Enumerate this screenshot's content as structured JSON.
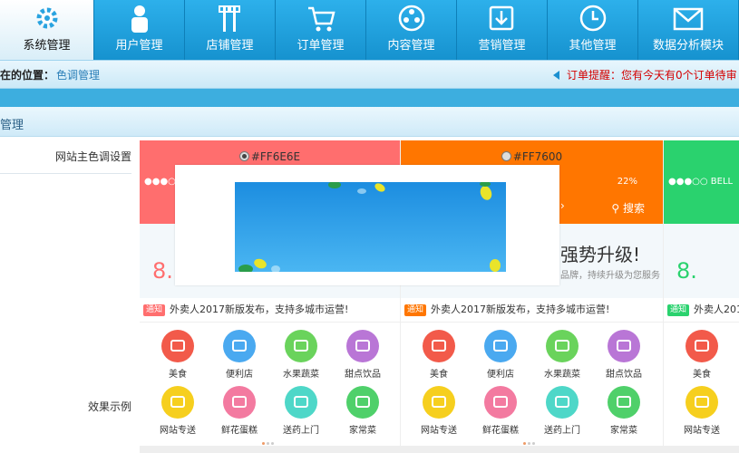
{
  "nav": {
    "tabs": [
      {
        "label": "系统管理",
        "icon": "gear-icon",
        "active": true
      },
      {
        "label": "用户管理",
        "icon": "user-icon",
        "active": false
      },
      {
        "label": "店铺管理",
        "icon": "tools-icon",
        "active": false
      },
      {
        "label": "订单管理",
        "icon": "cart-icon",
        "active": false
      },
      {
        "label": "内容管理",
        "icon": "film-reel-icon",
        "active": false
      },
      {
        "label": "营销管理",
        "icon": "download-box-icon",
        "active": false
      },
      {
        "label": "其他管理",
        "icon": "clock-icon",
        "active": false
      },
      {
        "label": "数据分析模块",
        "icon": "envelope-icon",
        "active": false
      }
    ]
  },
  "breadcrumb": {
    "prefix": "现在的位置：",
    "current": "色调管理"
  },
  "order_alert": {
    "label": "订单提醒：",
    "text": "您有今天有0个订单待审"
  },
  "section": {
    "title": "色调管理"
  },
  "form": {
    "theme_label": "网站主色调设置",
    "preview_label": "效果示例"
  },
  "themes": [
    {
      "hex": "#FF6E6E",
      "color": "#ff6e6e",
      "selected": true,
      "status_left": "●●●○○",
      "battery": "",
      "search": "",
      "banner_text": "",
      "banner_sub": "",
      "notice_tag": "通知",
      "notice": "外卖人2017新版发布，支持多城市运营!"
    },
    {
      "hex": "#FF7600",
      "color": "#ff7600",
      "selected": false,
      "status_left": "",
      "battery": "22%",
      "search": "搜索",
      "banner_text": "强势升级!",
      "banner_sub": "品牌，持续升级为您服务",
      "notice_tag": "通知",
      "notice": "外卖人2017新版发布，支持多城市运营!"
    },
    {
      "hex": "",
      "color": "#2ad26e",
      "selected": false,
      "status_left": "●●●○○ BELL",
      "battery": "",
      "search": "",
      "banner_text": "",
      "banner_sub": "",
      "notice_tag": "通知",
      "notice": "外卖人2017新"
    }
  ],
  "categories": [
    {
      "label": "美食",
      "color": "#f25a4a",
      "icon": "bowl-icon"
    },
    {
      "label": "便利店",
      "color": "#4aa9f0",
      "icon": "basket-icon"
    },
    {
      "label": "水果蔬菜",
      "color": "#6ad35c",
      "icon": "fruit-icon"
    },
    {
      "label": "甜点饮品",
      "color": "#b976d6",
      "icon": "drink-icon"
    },
    {
      "label": "网站专送",
      "color": "#f6cf1e",
      "icon": "scooter-icon"
    },
    {
      "label": "鲜花蛋糕",
      "color": "#f37aa0",
      "icon": "cake-icon"
    },
    {
      "label": "送药上门",
      "color": "#4ed7c8",
      "icon": "pill-icon"
    },
    {
      "label": "家常菜",
      "color": "#4fd06a",
      "icon": "dish-icon"
    }
  ]
}
